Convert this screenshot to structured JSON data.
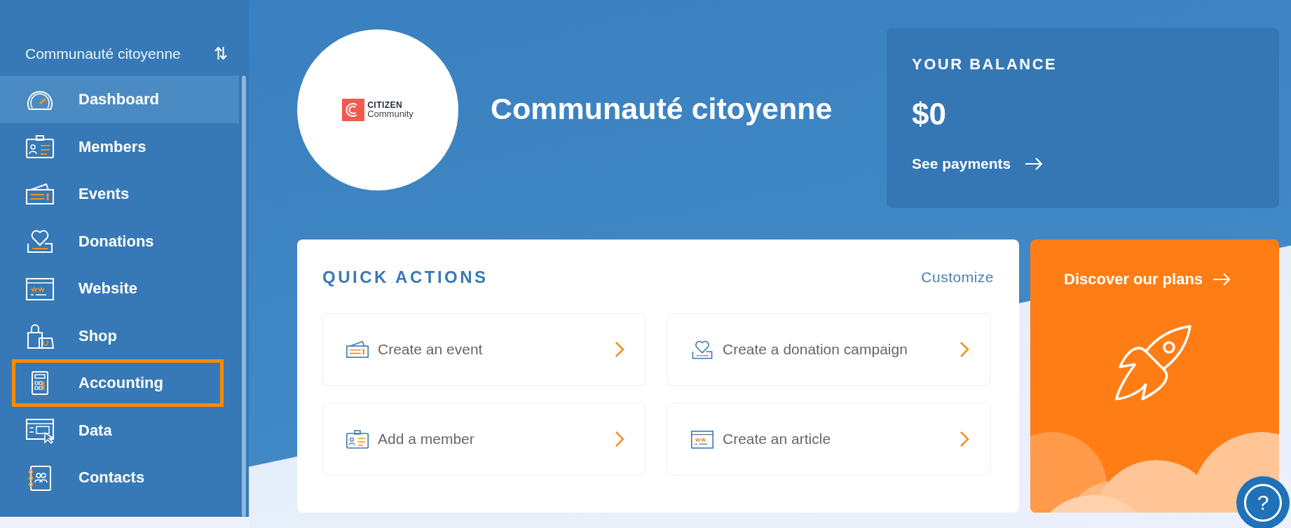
{
  "sidebar": {
    "organization": "Communauté citoyenne",
    "switch_icon": "⇅",
    "items": [
      {
        "label": "Dashboard",
        "selected": true,
        "highlighted": false
      },
      {
        "label": "Members",
        "selected": false,
        "highlighted": false
      },
      {
        "label": "Events",
        "selected": false,
        "highlighted": false
      },
      {
        "label": "Donations",
        "selected": false,
        "highlighted": false
      },
      {
        "label": "Website",
        "selected": false,
        "highlighted": false
      },
      {
        "label": "Shop",
        "selected": false,
        "highlighted": false
      },
      {
        "label": "Accounting",
        "selected": false,
        "highlighted": true
      },
      {
        "label": "Data",
        "selected": false,
        "highlighted": false
      },
      {
        "label": "Contacts",
        "selected": false,
        "highlighted": false
      }
    ]
  },
  "header": {
    "logo_line_1": "CITIZEN",
    "logo_line_2": "Community",
    "title": "Communauté citoyenne"
  },
  "balance": {
    "heading": "YOUR BALANCE",
    "amount": "$0",
    "link": "See payments"
  },
  "quick_actions": {
    "heading": "QUICK ACTIONS",
    "customize": "Customize",
    "actions": [
      {
        "label": "Create an event"
      },
      {
        "label": "Create a donation campaign"
      },
      {
        "label": "Add a member"
      },
      {
        "label": "Create an article"
      }
    ]
  },
  "plans": {
    "label": "Discover our plans"
  },
  "help": {
    "label": "?"
  }
}
